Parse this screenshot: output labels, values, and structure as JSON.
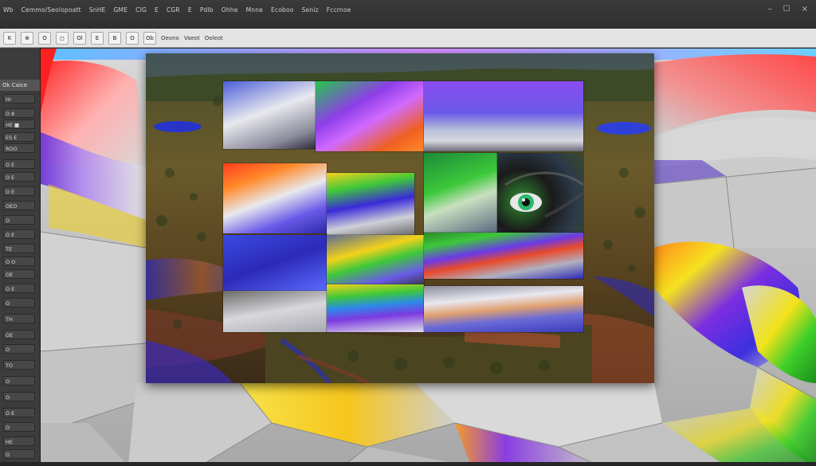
{
  "menubar": {
    "items": [
      "Wb",
      "Cemmo/Seolopoatt",
      "SnHE",
      "GME",
      "CIG",
      "E",
      "CGR",
      "E",
      "Pdlb",
      "Ohhe",
      "Mnne",
      "Ecoboo",
      "Seniz",
      "Fccrnoe"
    ],
    "window_controls": [
      "–",
      "☐",
      "×"
    ]
  },
  "optionsbar": {
    "items": [
      "K",
      "⊕",
      "O",
      "◻",
      "Ol",
      "E",
      "B",
      "O",
      "Ob",
      "Oeono",
      "Vaeot",
      "Ooleot"
    ]
  },
  "toolpanel": {
    "tab_label": "Ok Caice",
    "tools": [
      "Hr",
      "O 8",
      "HE ■",
      "ES E",
      "ROO",
      "O E",
      "O E",
      "O E",
      "OEO",
      "O",
      "O E",
      "TE",
      "O O",
      "OE",
      "O E",
      "O",
      "TH",
      "OE",
      "O",
      "TO",
      "O",
      "O",
      "O E",
      "O",
      "HE",
      "O"
    ]
  },
  "colors": {
    "panel_bg": "#3c3c3c",
    "menubar_bg": "#333333",
    "optionsbar_bg": "#e4e4e4",
    "canvas_bg": "#bdbdbd",
    "accent_red": "#e0343c",
    "accent_purple": "#7b3fd6",
    "accent_green": "#39b54a",
    "accent_blue": "#2c4fd8",
    "accent_yellow": "#f2d21b"
  }
}
